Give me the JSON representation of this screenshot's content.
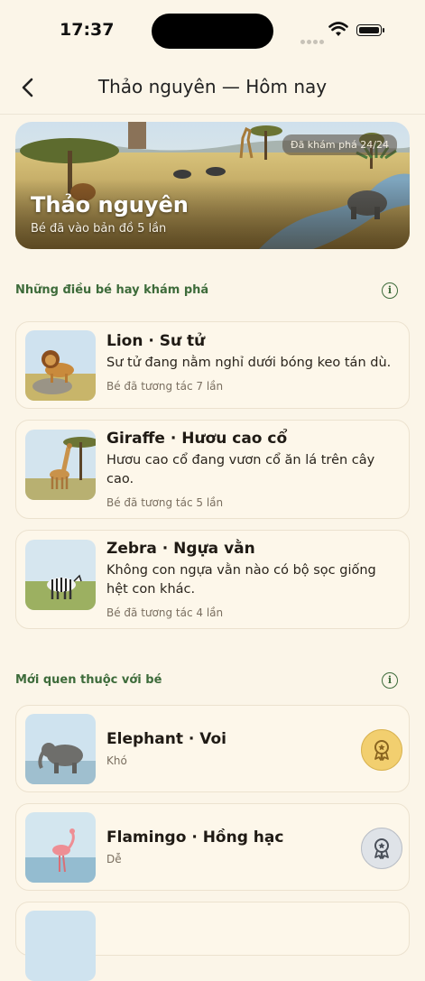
{
  "status": {
    "time": "17:37"
  },
  "nav": {
    "title": "Thảo nguyên — Hôm nay"
  },
  "hero": {
    "badge": "Đã khám phá 24/24",
    "title": "Thảo nguyên",
    "subtitle": "Bé đã vào bản đồ 5 lần"
  },
  "sections": {
    "explored": "Những điều bé hay khám phá",
    "familiar": "Mới quen thuộc với bé"
  },
  "explored": [
    {
      "title": "Lion · Sư tử",
      "desc": "Sư tử đang nằm nghỉ dưới bóng keo tán dù.",
      "meta": "Bé đã tương tác 7 lần"
    },
    {
      "title": "Giraffe · Hươu cao cổ",
      "desc": "Hươu cao cổ đang vươn cổ ăn lá trên cây cao.",
      "meta": "Bé đã tương tác 5 lần"
    },
    {
      "title": "Zebra · Ngựa vằn",
      "desc": "Không con ngựa vằn nào có bộ sọc giống hệt con khác.",
      "meta": "Bé đã tương tác 4 lần"
    }
  ],
  "familiar": [
    {
      "title": "Elephant · Voi",
      "meta": "Khó",
      "medal": "gold"
    },
    {
      "title": "Flamingo · Hồng hạc",
      "meta": "Dễ",
      "medal": "silver"
    }
  ],
  "icons": {
    "back": "chevron-left-icon",
    "info": "info-icon",
    "medal": "award-medal-icon"
  },
  "colors": {
    "accent_green": "#3d6b3a",
    "background": "#fbf5e8",
    "gold": "#f2cf6f",
    "silver": "#dfe3e8"
  }
}
